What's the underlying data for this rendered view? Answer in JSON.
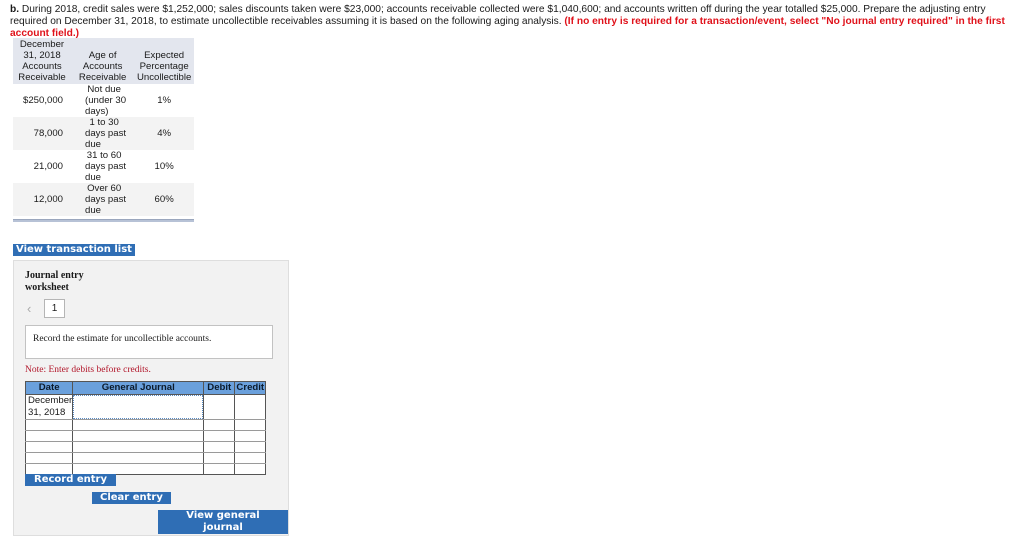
{
  "question": {
    "label": "b.",
    "text": " During 2018, credit sales were $1,252,000; sales discounts taken were $23,000; accounts receivable collected were $1,040,600; and accounts written off during the year totalled $25,000. Prepare the adjusting entry required on December 31, 2018, to estimate uncollectible receivables assuming it is based on the following aging analysis. ",
    "instruction": "(If no entry is required for a transaction/event, select \"No journal entry required\" in the first account field.)"
  },
  "aging_table": {
    "headers": [
      "December 31, 2018 Accounts Receivable",
      "Age of Accounts Receivable",
      "Expected Percentage Uncollectible"
    ],
    "rows": [
      {
        "amount": "$250,000",
        "age_l1": "Not due",
        "age_l2": "(under 30",
        "age_l3": "days)",
        "pct": "1%"
      },
      {
        "amount": "78,000",
        "age_l1": "1 to 30",
        "age_l2": "days past",
        "age_l3": "due",
        "pct": "4%"
      },
      {
        "amount": "21,000",
        "age_l1": "31 to 60",
        "age_l2": "days past",
        "age_l3": "due",
        "pct": "10%"
      },
      {
        "amount": "12,000",
        "age_l1": "Over 60",
        "age_l2": "days past",
        "age_l3": "due",
        "pct": "60%"
      }
    ]
  },
  "buttons": {
    "view_transaction_list": "View transaction list",
    "record_entry": "Record entry",
    "clear_entry": "Clear entry",
    "view_general_journal": "View general journal"
  },
  "worksheet": {
    "title": "Journal entry worksheet",
    "prev_icon": "chevron-left-icon",
    "page": "1",
    "description": "Record the estimate for uncollectible accounts.",
    "note": "Note: Enter debits before credits.",
    "columns": [
      "Date",
      "General Journal",
      "Debit",
      "Credit"
    ],
    "rows": [
      {
        "date": "December 31, 2018",
        "account": "",
        "debit": "",
        "credit": ""
      },
      {
        "date": "",
        "account": "",
        "debit": "",
        "credit": ""
      },
      {
        "date": "",
        "account": "",
        "debit": "",
        "credit": ""
      },
      {
        "date": "",
        "account": "",
        "debit": "",
        "credit": ""
      },
      {
        "date": "",
        "account": "",
        "debit": "",
        "credit": ""
      },
      {
        "date": "",
        "account": "",
        "debit": "",
        "credit": ""
      }
    ]
  },
  "colors": {
    "button_blue": "#2f6eb5",
    "instruction_red": "#e0121b",
    "table_header_blue": "#6aa0dc",
    "note_red": "#b2162a"
  }
}
